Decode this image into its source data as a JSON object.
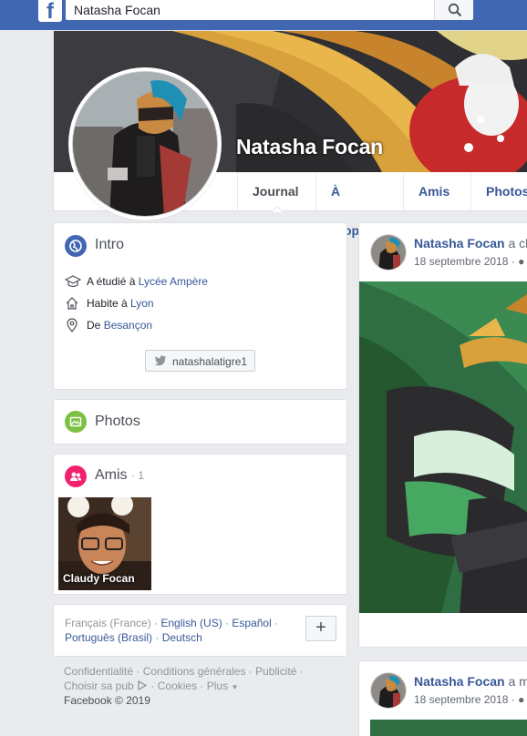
{
  "topbar": {
    "logo_letter": "f",
    "search_value": "Natasha Focan",
    "search_icon": "search-icon"
  },
  "profile": {
    "name": "Natasha Focan",
    "tabs": [
      {
        "label": "Journal"
      },
      {
        "label": "À propos"
      },
      {
        "label": "Amis"
      },
      {
        "label": "Photos"
      }
    ]
  },
  "intro": {
    "title": "Intro",
    "studied_prefix": "A étudié à ",
    "studied_place": "Lycée Ampère",
    "lives_prefix": "Habite à ",
    "lives_place": "Lyon",
    "from_prefix": "De ",
    "from_place": "Besançon",
    "twitter_handle": "natashalatigre1"
  },
  "photos": {
    "title": "Photos"
  },
  "friends": {
    "title": "Amis",
    "count": "· 1",
    "items": [
      {
        "name": "Claudy Focan"
      }
    ]
  },
  "languages": {
    "current": "Français (France)",
    "sep": " · ",
    "line1": [
      "English (US)",
      "Español"
    ],
    "line2": [
      "Português (Brasil)",
      "Deutsch"
    ],
    "add_label": "+"
  },
  "footer": {
    "line1": "Confidentialité · Conditions générales · Publicité ·",
    "line2a": "Choisir sa pub",
    "line2b": " · Cookies · Plus",
    "copyright": "Facebook © 2019"
  },
  "posts": [
    {
      "author": "Natasha Focan",
      "action": " a cl",
      "date": "18 septembre 2018 · "
    },
    {
      "author": "Natasha Focan",
      "action": " a m",
      "date": "18 septembre 2018 · "
    }
  ],
  "colors": {
    "brand": "#4267b2",
    "link": "#385898",
    "intro_icon": "#4267b2",
    "photos_icon": "#7bc144",
    "friends_icon": "#f2216e"
  }
}
